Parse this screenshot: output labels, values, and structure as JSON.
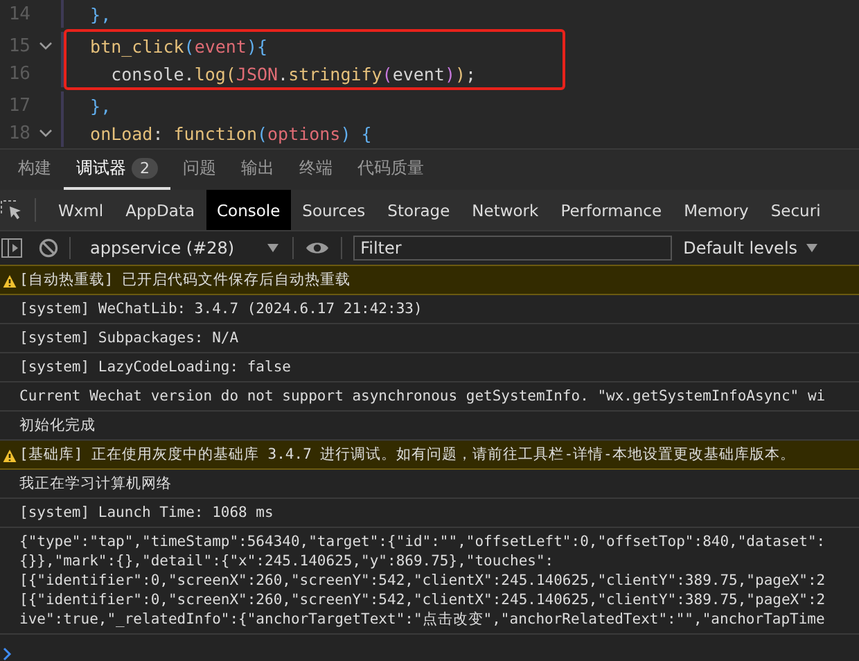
{
  "editor": {
    "lines": [
      {
        "number": "14",
        "foldable": false,
        "highlighted": false,
        "tokens": [
          {
            "kind": "punct",
            "text": "  },"
          }
        ]
      },
      {
        "number": "15",
        "foldable": true,
        "highlighted": true,
        "tokens": [
          {
            "kind": "func",
            "text": "  btn_click"
          },
          {
            "kind": "punct",
            "text": "("
          },
          {
            "kind": "param",
            "text": "event"
          },
          {
            "kind": "punct",
            "text": "){"
          }
        ]
      },
      {
        "number": "16",
        "foldable": false,
        "highlighted": true,
        "tokens": [
          {
            "kind": "plain",
            "text": "    console."
          },
          {
            "kind": "func",
            "text": "log"
          },
          {
            "kind": "paren",
            "text": "("
          },
          {
            "kind": "param",
            "text": "JSON"
          },
          {
            "kind": "plain",
            "text": "."
          },
          {
            "kind": "func",
            "text": "stringify"
          },
          {
            "kind": "paren2",
            "text": "("
          },
          {
            "kind": "plain",
            "text": "event"
          },
          {
            "kind": "paren2",
            "text": ")"
          },
          {
            "kind": "paren",
            "text": ")"
          },
          {
            "kind": "plain",
            "text": ";"
          }
        ]
      },
      {
        "number": "17",
        "foldable": false,
        "highlighted": false,
        "tokens": [
          {
            "kind": "punct",
            "text": "  },"
          }
        ]
      },
      {
        "number": "18",
        "foldable": true,
        "highlighted": false,
        "tokens": [
          {
            "kind": "func",
            "text": "  onLoad"
          },
          {
            "kind": "plain",
            "text": ": "
          },
          {
            "kind": "keyword",
            "text": "function"
          },
          {
            "kind": "punct",
            "text": "("
          },
          {
            "kind": "param",
            "text": "options"
          },
          {
            "kind": "punct",
            "text": ") {"
          }
        ]
      }
    ]
  },
  "panel_tabs": [
    {
      "label": "构建",
      "selected": false
    },
    {
      "label": "调试器",
      "selected": true,
      "badge": "2"
    },
    {
      "label": "问题",
      "selected": false
    },
    {
      "label": "输出",
      "selected": false
    },
    {
      "label": "终端",
      "selected": false
    },
    {
      "label": "代码质量",
      "selected": false
    }
  ],
  "devtools_tabs": [
    {
      "label": "Wxml",
      "selected": false
    },
    {
      "label": "AppData",
      "selected": false
    },
    {
      "label": "Console",
      "selected": true
    },
    {
      "label": "Sources",
      "selected": false
    },
    {
      "label": "Storage",
      "selected": false
    },
    {
      "label": "Network",
      "selected": false
    },
    {
      "label": "Performance",
      "selected": false
    },
    {
      "label": "Memory",
      "selected": false
    },
    {
      "label": "Securi",
      "selected": false
    }
  ],
  "toolbar": {
    "context": "appservice (#28)",
    "filter": {
      "placeholder": "Filter"
    },
    "levels": "Default levels"
  },
  "console": [
    {
      "kind": "warning",
      "lines": [
        "[自动热重载] 已开启代码文件保存后自动热重载"
      ]
    },
    {
      "kind": "log",
      "lines": [
        "[system] WeChatLib: 3.4.7 (2024.6.17 21:42:33)"
      ]
    },
    {
      "kind": "log",
      "lines": [
        "[system] Subpackages: N/A"
      ]
    },
    {
      "kind": "log",
      "lines": [
        "[system] LazyCodeLoading: false"
      ]
    },
    {
      "kind": "log",
      "lines": [
        "Current Wechat version do not support asynchronous getSystemInfo. \"wx.getSystemInfoAsync\" wi"
      ]
    },
    {
      "kind": "log",
      "lines": [
        "初始化完成"
      ]
    },
    {
      "kind": "warning",
      "lines": [
        "[基础库] 正在使用灰度中的基础库 3.4.7 进行调试。如有问题，请前往工具栏-详情-本地设置更改基础库版本。"
      ]
    },
    {
      "kind": "log",
      "lines": [
        "我正在学习计算机网络"
      ]
    },
    {
      "kind": "log",
      "lines": [
        "[system] Launch Time: 1068 ms"
      ]
    },
    {
      "kind": "log",
      "lines": [
        "{\"type\":\"tap\",\"timeStamp\":564340,\"target\":{\"id\":\"\",\"offsetLeft\":0,\"offsetTop\":840,\"dataset\":",
        "{}},\"mark\":{},\"detail\":{\"x\":245.140625,\"y\":869.75},\"touches\":",
        "[{\"identifier\":0,\"screenX\":260,\"screenY\":542,\"clientX\":245.140625,\"clientY\":389.75,\"pageX\":2",
        "[{\"identifier\":0,\"screenX\":260,\"screenY\":542,\"clientX\":245.140625,\"clientY\":389.75,\"pageX\":2",
        "ive\":true,\"_relatedInfo\":{\"anchorTargetText\":\"点击改变\",\"anchorRelatedText\":\"\",\"anchorTapTime"
      ]
    }
  ]
}
